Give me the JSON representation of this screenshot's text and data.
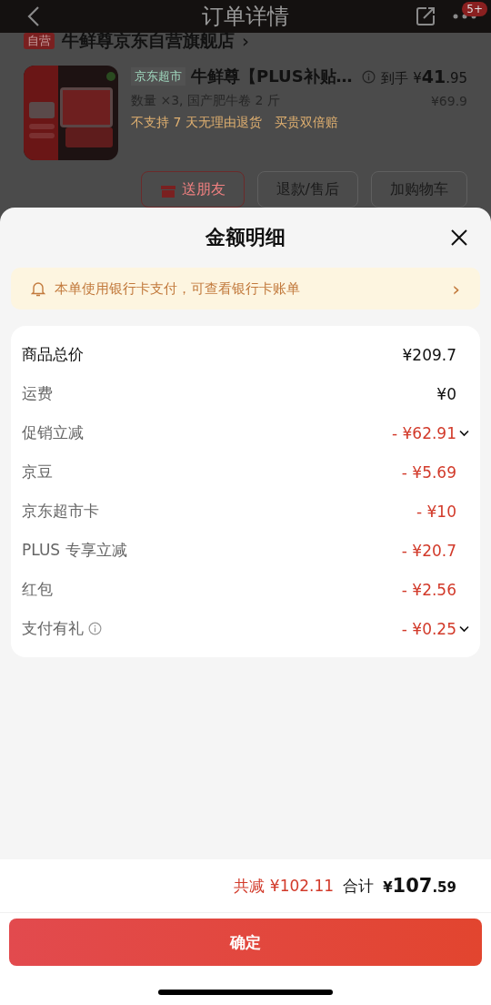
{
  "nav": {
    "title": "订单详情",
    "badge": "5+"
  },
  "store": {
    "badge": "自营",
    "name": "牛鲜尊京东自营旗舰店",
    "chevron": "›"
  },
  "product": {
    "image": {
      "kind": "picture"
    },
    "tag": "京东超市",
    "name": "牛鲜尊【PLUS补贴…",
    "final_label": "到手",
    "final_currency": "¥",
    "final_int": "41",
    "final_dec": ".95",
    "spec": "数量 ×3, 国产肥牛卷 2 斤",
    "price": "¥69.9",
    "notes": [
      "不支持 7 天无理由退货",
      "买贵双倍赔"
    ]
  },
  "actions": [
    {
      "label": "送朋友",
      "kind": "gift"
    },
    {
      "label": "退款/售后",
      "kind": "plain"
    },
    {
      "label": "加购物车",
      "kind": "plain"
    }
  ],
  "sheet": {
    "title": "金额明细",
    "notice": "本单使用银行卡支付，可查看银行卡账单",
    "notice_chevron": "›",
    "rows": [
      {
        "label": "商品总价",
        "amount": "¥209.7",
        "kind": "total",
        "expandable": false,
        "info": false
      },
      {
        "label": "运费",
        "amount": "¥0",
        "kind": "charge",
        "expandable": false,
        "info": false
      },
      {
        "label": "促销立减",
        "amount": "- ¥62.91",
        "kind": "discount",
        "expandable": true,
        "info": false
      },
      {
        "label": "京豆",
        "amount": "- ¥5.69",
        "kind": "discount",
        "expandable": false,
        "info": false
      },
      {
        "label": "京东超市卡",
        "amount": "- ¥10",
        "kind": "discount",
        "expandable": false,
        "info": false
      },
      {
        "label": "PLUS 专享立减",
        "amount": "- ¥20.7",
        "kind": "discount",
        "expandable": false,
        "info": false
      },
      {
        "label": "红包",
        "amount": "- ¥2.56",
        "kind": "discount",
        "expandable": false,
        "info": false
      },
      {
        "label": "支付有礼",
        "amount": "- ¥0.25",
        "kind": "discount",
        "expandable": true,
        "info": true
      }
    ]
  },
  "footer": {
    "saved": "共减 ¥102.11",
    "total_label": "合计",
    "total_currency": "¥",
    "total_int": "107",
    "total_dec": ".59",
    "confirm": "确定"
  }
}
